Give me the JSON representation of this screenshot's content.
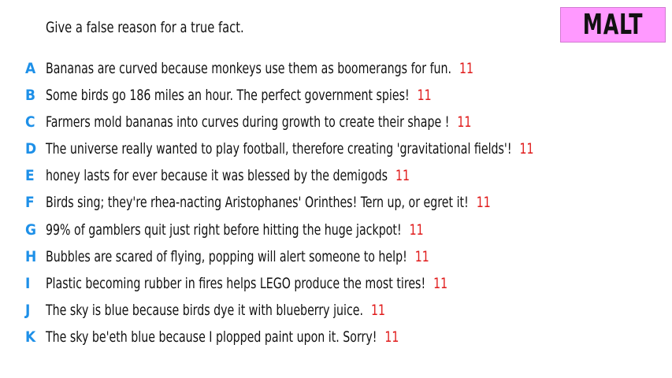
{
  "prompt": "Give a false reason for a true fact.",
  "badge": "MALT",
  "items": [
    {
      "letter": "A",
      "text": "Bananas are curved because monkeys use them as boomerangs for fun.",
      "count": "11"
    },
    {
      "letter": "B",
      "text": "Some birds go 186 miles an hour. The perfect government spies!",
      "count": "11"
    },
    {
      "letter": "C",
      "text": "Farmers mold bananas into curves during growth to create their shape !",
      "count": "11"
    },
    {
      "letter": "D",
      "text": "The universe really wanted to play football, therefore creating 'gravitational fields'!",
      "count": "11"
    },
    {
      "letter": "E",
      "text": "honey lasts for ever because it was blessed by the demigods",
      "count": "11"
    },
    {
      "letter": "F",
      "text": "Birds sing; they're rhea-nacting Aristophanes' Orinthes! Tern up, or egret it!",
      "count": "11"
    },
    {
      "letter": "G",
      "text": "99% of gamblers quit just right before hitting the huge jackpot!",
      "count": "11"
    },
    {
      "letter": "H",
      "text": "Bubbles are scared of flying, popping will alert someone to help!",
      "count": "11"
    },
    {
      "letter": "I",
      "text": "Plastic becoming rubber in fires helps LEGO produce the most tires!",
      "count": "11"
    },
    {
      "letter": "J",
      "text": "The sky is blue because birds dye it with blueberry juice.",
      "count": "11"
    },
    {
      "letter": "K",
      "text": "The sky be'eth blue because I plopped paint upon it. Sorry!",
      "count": "11"
    }
  ]
}
